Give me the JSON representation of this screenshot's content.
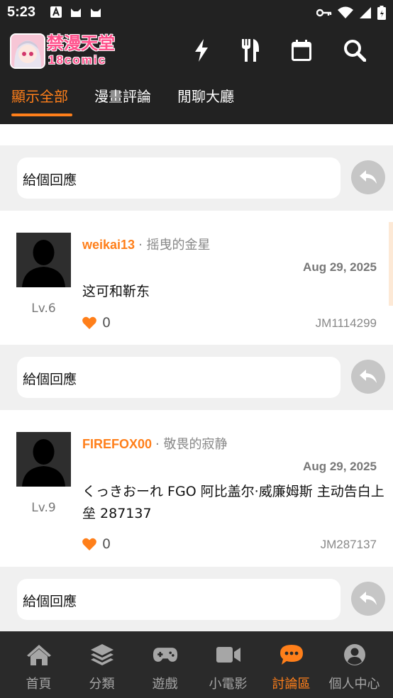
{
  "status_bar": {
    "time": "5:23"
  },
  "app": {
    "logo_title": "禁漫天堂",
    "logo_sub": "18comic"
  },
  "tabs": [
    {
      "label": "顯示全部",
      "active": true
    },
    {
      "label": "漫畫評論",
      "active": false
    },
    {
      "label": "閒聊大廳",
      "active": false
    }
  ],
  "reply": {
    "placeholder": "給個回應"
  },
  "comments": [
    {
      "username": "weikai13",
      "title": "· 摇曳的金星",
      "date": "Aug 29, 2025",
      "level": "Lv.6",
      "text": "这可和靳东",
      "likes": "0",
      "comic_id": "JM1114299"
    },
    {
      "username": "FIREFOX00",
      "title": "· 敬畏的寂静",
      "date": "Aug 29, 2025",
      "level": "Lv.9",
      "text": "くっきおーれ FGO 阿比盖尔·威廉姆斯 主动告白上垒 287137",
      "likes": "0",
      "comic_id": "JM287137"
    }
  ],
  "bottom_nav": [
    {
      "label": "首頁",
      "icon": "home-icon",
      "active": false
    },
    {
      "label": "分類",
      "icon": "layers-icon",
      "active": false
    },
    {
      "label": "遊戲",
      "icon": "gamepad-icon",
      "active": false
    },
    {
      "label": "小電影",
      "icon": "video-icon",
      "active": false
    },
    {
      "label": "討論區",
      "icon": "chat-icon",
      "active": true
    },
    {
      "label": "個人中心",
      "icon": "user-icon",
      "active": false
    }
  ],
  "colors": {
    "accent": "#ff7f1a",
    "header_bg": "#222222",
    "nav_bg": "#2a2a2a",
    "reply_btn": "#c6c6c6"
  }
}
